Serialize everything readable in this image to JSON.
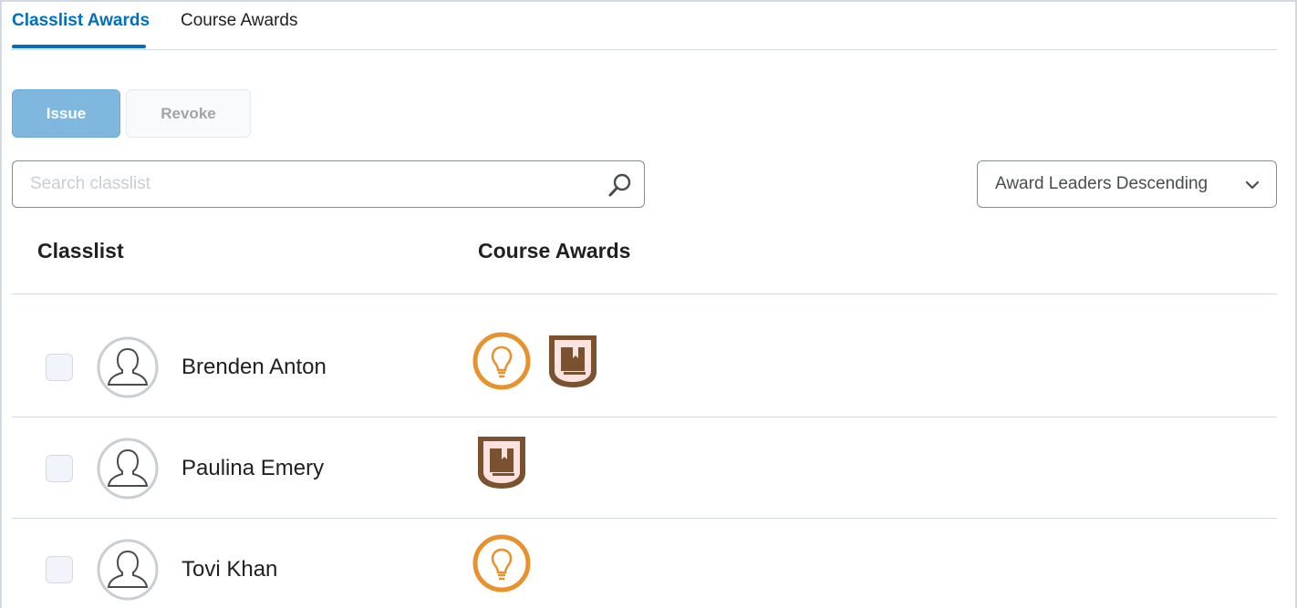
{
  "tabs": {
    "classlist_awards": "Classlist Awards",
    "course_awards": "Course Awards"
  },
  "actions": {
    "issue_label": "Issue",
    "revoke_label": "Revoke"
  },
  "search": {
    "placeholder": "Search classlist",
    "icon": "search-icon"
  },
  "sort": {
    "selected": "Award Leaders Descending",
    "icon": "chevron-down-icon"
  },
  "columns": {
    "classlist": "Classlist",
    "course_awards": "Course Awards"
  },
  "students": [
    {
      "name": "Brenden Anton",
      "awards": [
        "lightbulb-award",
        "book-award"
      ]
    },
    {
      "name": "Paulina Emery",
      "awards": [
        "book-award"
      ]
    },
    {
      "name": "Tovi Khan",
      "awards": [
        "lightbulb-award"
      ]
    }
  ],
  "colors": {
    "accent": "#006fbf",
    "issue_button": "#7fb7df",
    "lightbulb_award": "#e8922e",
    "book_award": "#7a5230",
    "book_award_fill": "#fde3e0"
  }
}
